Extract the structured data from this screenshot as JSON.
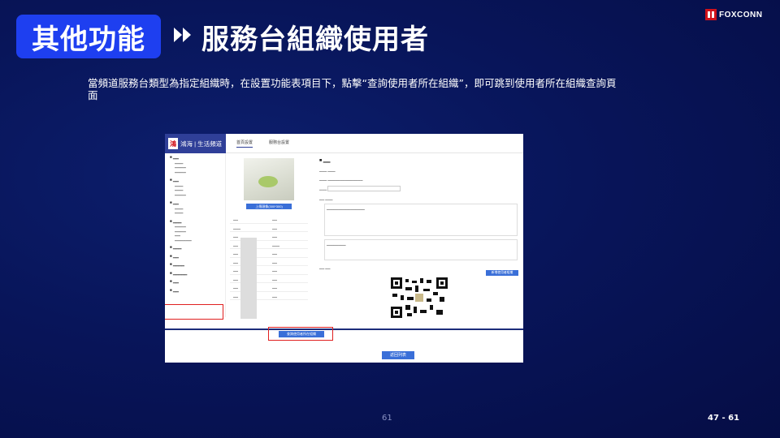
{
  "header": {
    "section_label": "其他功能",
    "title": "服務台組織使用者",
    "logo_text": "FOXCONN"
  },
  "description": "當頻道服務台類型為指定組織時，在設置功能表項目下，點擊“查詢使用者所在組織”，即可跳到使用者所在組織查詢頁面",
  "screenshot": {
    "brand": "鴻海 | 生活頻道",
    "tabs": [
      "首頁設置",
      "服務台設置"
    ],
    "upload_button": "上傳頭像(300*300)",
    "query_button": "查詢使用者所在組織",
    "back_button": "返回列表",
    "add_button": "新增使用者組織"
  },
  "footer": {
    "page_number": "61",
    "page_range": "47 - 61"
  },
  "colors": {
    "accent": "#1e3ff0",
    "highlight": "#e02020",
    "background": "#08155a"
  }
}
